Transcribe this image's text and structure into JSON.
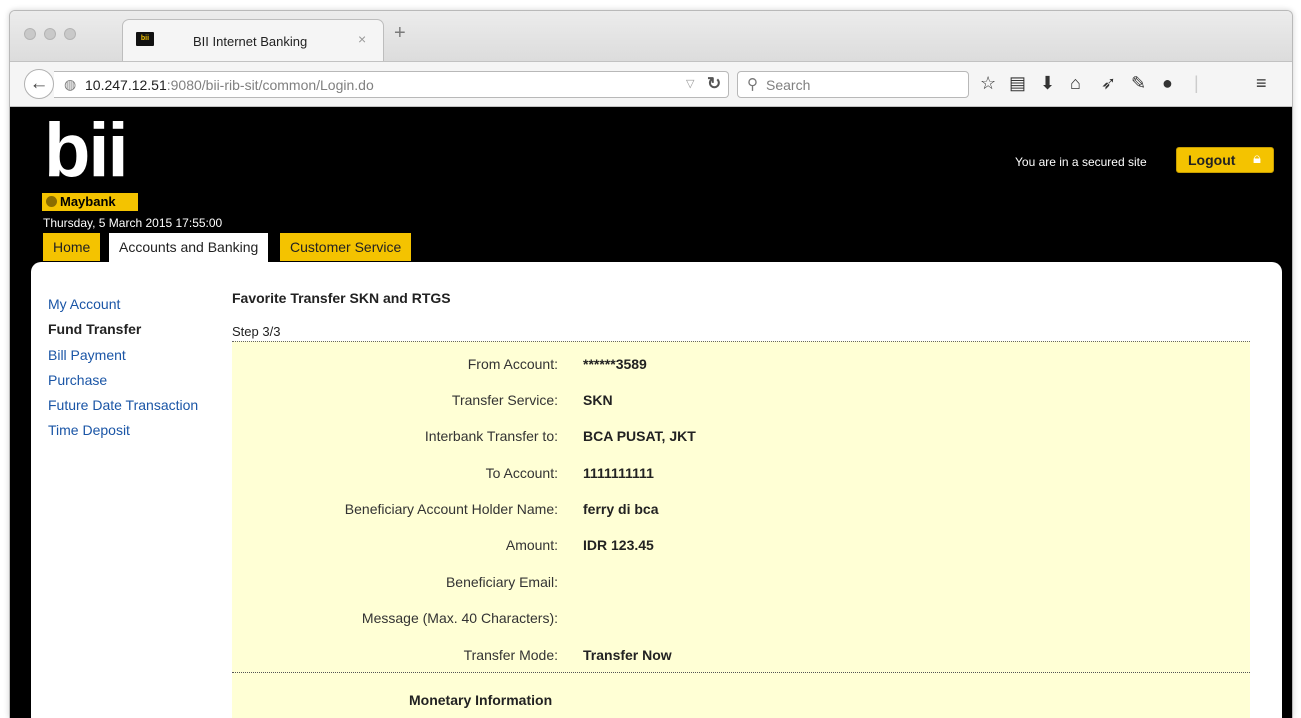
{
  "browser": {
    "tab_title": "BII Internet Banking",
    "favicon_text": "bii",
    "url_host": "10.247.12.51",
    "url_rest": ":9080/bii-rib-sit/common/Login.do",
    "search_placeholder": "Search",
    "icons": [
      "back-arrow-icon",
      "globe-icon",
      "reload-icon",
      "search-icon",
      "star-icon",
      "reader-icon",
      "download-icon",
      "home-icon",
      "send-icon",
      "note-icon",
      "chat-icon",
      "menu-icon"
    ]
  },
  "header": {
    "logo": "bii",
    "brand": "Maybank",
    "datetime": "Thursday, 5 March 2015 17:55:00",
    "secured_text": "You are in a secured site",
    "logout_label": "Logout"
  },
  "tabs": [
    {
      "label": "Home",
      "active": false
    },
    {
      "label": "Accounts and Banking",
      "active": true
    },
    {
      "label": "Customer Service",
      "active": false
    }
  ],
  "sidebar": {
    "items": [
      {
        "label": "My Account",
        "active": false
      },
      {
        "label": "Fund Transfer",
        "active": true
      },
      {
        "label": "Bill Payment",
        "active": false
      },
      {
        "label": "Purchase",
        "active": false
      },
      {
        "label": "Future Date Transaction",
        "active": false
      },
      {
        "label": "Time Deposit",
        "active": false
      }
    ]
  },
  "main": {
    "title": "Favorite Transfer SKN and RTGS",
    "step": "Step 3/3",
    "fields": [
      {
        "label": "From Account:",
        "value": "******3589"
      },
      {
        "label": "Transfer Service:",
        "value": "SKN"
      },
      {
        "label": "Interbank Transfer to:",
        "value": "BCA PUSAT, JKT"
      },
      {
        "label": "To Account:",
        "value": "1111111111"
      },
      {
        "label": "Beneficiary Account Holder Name:",
        "value": "ferry di bca"
      },
      {
        "label": "Amount:",
        "value": "IDR 123.45"
      },
      {
        "label": "Beneficiary Email:",
        "value": ""
      },
      {
        "label": "Message (Max. 40 Characters):",
        "value": ""
      },
      {
        "label": "Transfer Mode:",
        "value": "Transfer Now"
      }
    ],
    "section_label": "Monetary Information"
  },
  "colors": {
    "accent_yellow": "#f4c300",
    "panel_bg": "#ffffd5",
    "link_blue": "#1a55a6",
    "header_bg": "#000000"
  }
}
